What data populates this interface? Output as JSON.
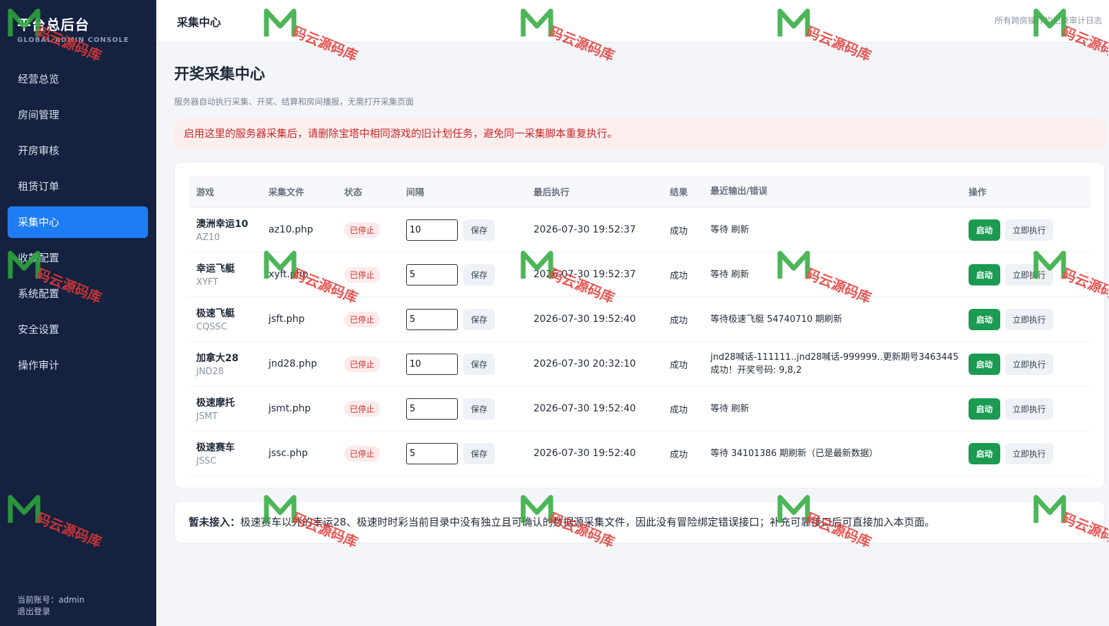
{
  "sidebar": {
    "brand_title": "平台总后台",
    "brand_subtitle": "GLOBAL ADMIN CONSOLE",
    "items": [
      {
        "label": "经营总览",
        "active": false
      },
      {
        "label": "房间管理",
        "active": false
      },
      {
        "label": "开房审核",
        "active": false
      },
      {
        "label": "租赁订单",
        "active": false
      },
      {
        "label": "采集中心",
        "active": true
      },
      {
        "label": "收款配置",
        "active": false
      },
      {
        "label": "系统配置",
        "active": false
      },
      {
        "label": "安全设置",
        "active": false
      },
      {
        "label": "操作审计",
        "active": false
      }
    ],
    "account_text": "当前账号：admin",
    "logout_label": "退出登录"
  },
  "topbar": {
    "title": "采集中心",
    "note": "所有跨房操作均记录审计日志"
  },
  "page": {
    "title": "开奖采集中心",
    "description": "服务器自动执行采集、开奖、结算和房间播报，无需打开采集页面",
    "alert": "启用这里的服务器采集后，请删除宝塔中相同游戏的旧计划任务，避免同一采集脚本重复执行。"
  },
  "table": {
    "headers": {
      "game": "游戏",
      "file": "采集文件",
      "status": "状态",
      "interval": "间隔",
      "last_run": "最后执行",
      "result": "结果",
      "output": "最近输出/错误",
      "ops": "操作"
    },
    "save_label": "保存",
    "start_label": "启动",
    "run_label": "立即执行",
    "rows": [
      {
        "name": "澳洲幸运10",
        "code": "AZ10",
        "file": "az10.php",
        "status": "已停止",
        "interval": "10",
        "last_run": "2026-07-30 19:52:37",
        "result": "成功",
        "output": "等待 刷新"
      },
      {
        "name": "幸运飞艇",
        "code": "XYFT",
        "file": "xyft.php",
        "status": "已停止",
        "interval": "5",
        "last_run": "2026-07-30 19:52:37",
        "result": "成功",
        "output": "等待 刷新"
      },
      {
        "name": "极速飞艇",
        "code": "CQSSC",
        "file": "jsft.php",
        "status": "已停止",
        "interval": "5",
        "last_run": "2026-07-30 19:52:40",
        "result": "成功",
        "output": "等待极速飞艇 54740710 期刷新"
      },
      {
        "name": "加拿大28",
        "code": "JND28",
        "file": "jnd28.php",
        "status": "已停止",
        "interval": "10",
        "last_run": "2026-07-30 20:32:10",
        "result": "成功",
        "output": "jnd28喊话-111111..jnd28喊话-999999..更新期号3463445 成功！开奖号码: 9,8,2"
      },
      {
        "name": "极速摩托",
        "code": "JSMT",
        "file": "jsmt.php",
        "status": "已停止",
        "interval": "5",
        "last_run": "2026-07-30 19:52:40",
        "result": "成功",
        "output": "等待 刷新"
      },
      {
        "name": "极速赛车",
        "code": "JSSC",
        "file": "jssc.php",
        "status": "已停止",
        "interval": "5",
        "last_run": "2026-07-30 19:52:40",
        "result": "成功",
        "output": "等待 34101386 期刷新（已是最新数据）"
      }
    ]
  },
  "note": {
    "label": "暂未接入：",
    "text": "极速赛车以外的幸运28、极速时时彩当前目录中没有独立且可确认的数据源采集文件，因此没有冒险绑定错误接口；补充可靠接口后可直接加入本页面。"
  },
  "watermark": {
    "text": "码云源码库"
  },
  "colors": {
    "sidebar_bg": "#14213f",
    "accent": "#1d7cf2",
    "start_green": "#1b9a52",
    "danger": "#c62828"
  }
}
